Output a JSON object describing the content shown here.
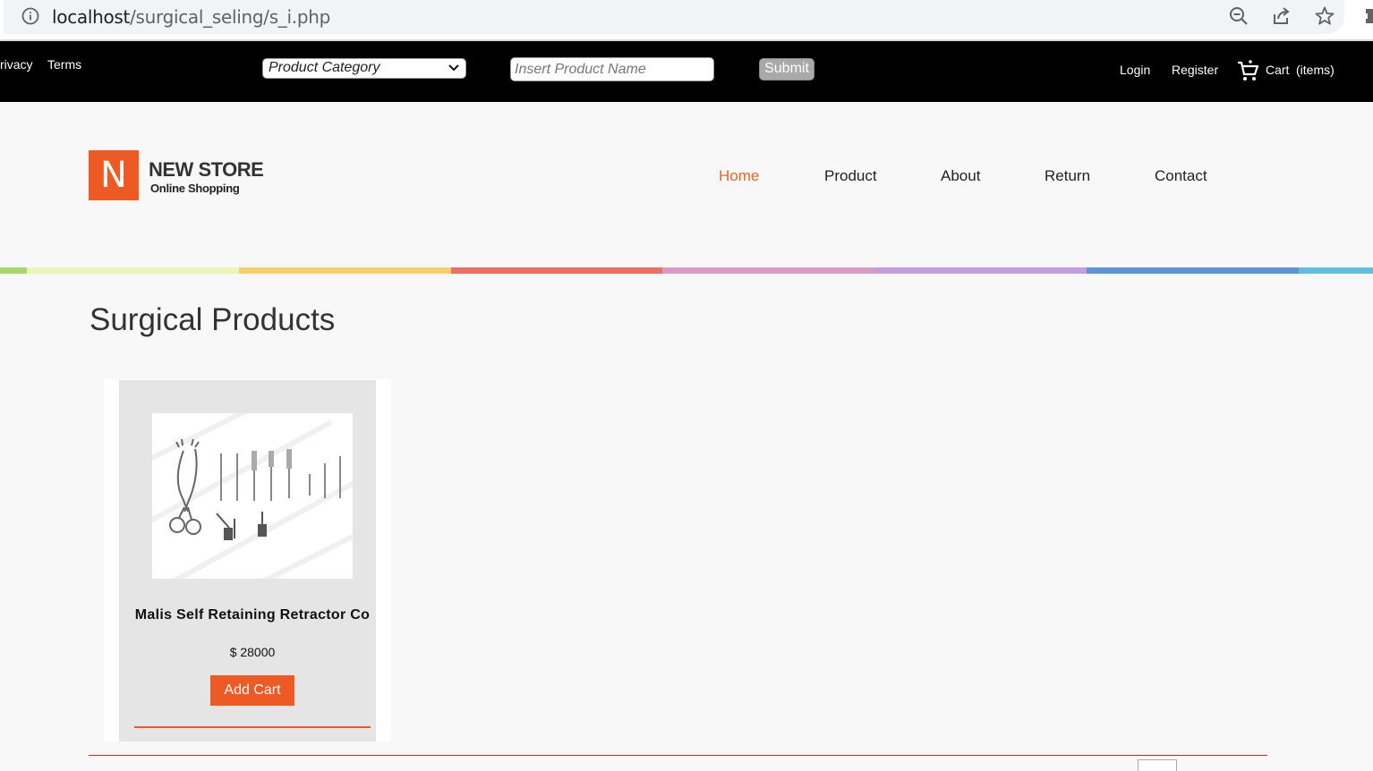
{
  "browser": {
    "url_host": "localhost",
    "url_path": "/surgical_seling/s_i.php",
    "icons": [
      "info-icon",
      "zoom-icon",
      "share-icon",
      "star-icon",
      "extensions-icon"
    ]
  },
  "topbar": {
    "left_links": [
      "rivacy",
      "Terms"
    ],
    "category_select": "Product Category",
    "search_placeholder": "Insert Product Name",
    "submit_label": "Submit",
    "login": "Login",
    "register": "Register",
    "cart_label": "Cart",
    "cart_items": "(items)"
  },
  "header": {
    "logo_letter": "N",
    "logo_title": "NEW STORE",
    "logo_subtitle": "Online Shopping",
    "nav": [
      "Home",
      "Product",
      "About",
      "Return",
      "Contact"
    ],
    "active_nav": "Home",
    "strip_colors": [
      "#a8d86a",
      "#eef5b8",
      "#f9cf6d",
      "#ee6e63",
      "#d99bc6",
      "#c39de0",
      "#5b94db",
      "#5ebfe0"
    ]
  },
  "main": {
    "title": "Surgical Products",
    "products": [
      {
        "name": "Malis Self Retaining Retractor Co",
        "price": "$ 28000",
        "button": "Add Cart"
      }
    ]
  },
  "colors": {
    "accent": "#ee5a24",
    "topbar_bg": "#000000"
  }
}
